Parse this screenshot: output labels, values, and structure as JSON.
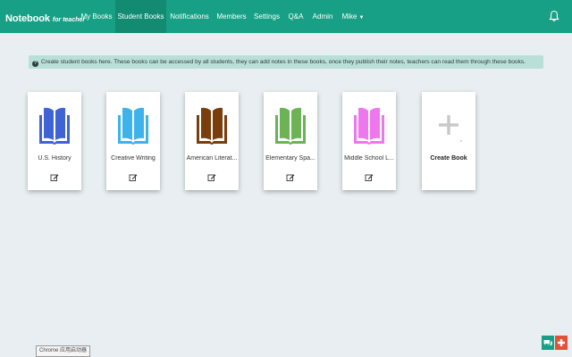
{
  "brand": {
    "name": "Notebook",
    "subtitle": "for teacher"
  },
  "nav": {
    "items": [
      {
        "label": "My Books",
        "active": false
      },
      {
        "label": "Student Books",
        "active": true
      },
      {
        "label": "Notifications",
        "active": false
      },
      {
        "label": "Members",
        "active": false
      },
      {
        "label": "Settings",
        "active": false
      },
      {
        "label": "Q&A",
        "active": false
      },
      {
        "label": "Admin",
        "active": false
      },
      {
        "label": "Mike",
        "active": false
      }
    ]
  },
  "info": {
    "text": "Create student books here. These books can be accessed by all students, they can add notes in these books, once they publish their notes, teachers can read them through these books."
  },
  "books": [
    {
      "title": "U.S. History",
      "color": "#3f62d6"
    },
    {
      "title": "Creative Writing",
      "color": "#3eb2ea"
    },
    {
      "title": "American Literat...",
      "color": "#7a3d0c"
    },
    {
      "title": "Elementary Spa...",
      "color": "#6bb355"
    },
    {
      "title": "Middle School L...",
      "color": "#ee77ee"
    }
  ],
  "create_book": {
    "label": "Create Book"
  },
  "tooltip": {
    "text": "Chrome 应用启动器"
  },
  "colors": {
    "navbar": "#17a085",
    "navbar_active": "#138a72",
    "info_bar": "#b9e0d8",
    "background": "#e8eef1"
  },
  "icons": {
    "bell": "bell-icon",
    "info": "info-icon",
    "edit": "edit-icon",
    "plus": "plus-icon",
    "chat": "chat-icon",
    "help": "help-icon"
  }
}
